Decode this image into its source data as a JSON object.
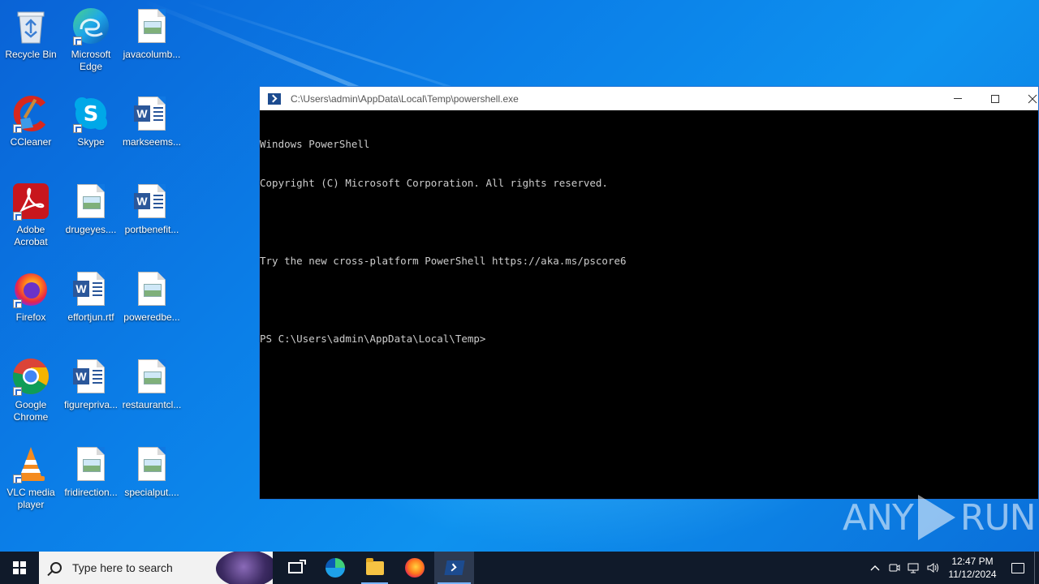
{
  "desktop": {
    "icons": [
      {
        "label": "Recycle Bin",
        "icon": "recycle-bin-icon"
      },
      {
        "label": "Microsoft Edge",
        "icon": "edge-icon"
      },
      {
        "label": "javacolumb...",
        "icon": "image-file-icon"
      },
      {
        "label": "CCleaner",
        "icon": "ccleaner-icon"
      },
      {
        "label": "Skype",
        "icon": "skype-icon"
      },
      {
        "label": "markseems...",
        "icon": "word-doc-icon"
      },
      {
        "label": "Adobe Acrobat",
        "icon": "acrobat-icon"
      },
      {
        "label": "drugeyes....",
        "icon": "image-file-icon"
      },
      {
        "label": "portbenefit...",
        "icon": "word-doc-icon"
      },
      {
        "label": "Firefox",
        "icon": "firefox-icon"
      },
      {
        "label": "effortjun.rtf",
        "icon": "word-doc-icon"
      },
      {
        "label": "poweredbe...",
        "icon": "image-file-icon"
      },
      {
        "label": "Google Chrome",
        "icon": "chrome-icon"
      },
      {
        "label": "figurepriva...",
        "icon": "word-doc-icon"
      },
      {
        "label": "restaurantcl...",
        "icon": "image-file-icon"
      },
      {
        "label": "VLC media player",
        "icon": "vlc-icon"
      },
      {
        "label": "fridirection...",
        "icon": "image-file-icon"
      },
      {
        "label": "specialput....",
        "icon": "image-file-icon"
      }
    ]
  },
  "window": {
    "title": "C:\\Users\\admin\\AppData\\Local\\Temp\\powershell.exe",
    "console_lines": [
      "Windows PowerShell",
      "Copyright (C) Microsoft Corporation. All rights reserved.",
      "",
      "Try the new cross-platform PowerShell https://aka.ms/pscore6",
      "",
      "PS C:\\Users\\admin\\AppData\\Local\\Temp>"
    ]
  },
  "watermark": {
    "left": "ANY",
    "right": "RUN"
  },
  "taskbar": {
    "search_placeholder": "Type here to search",
    "apps": [
      "task-view-icon",
      "edge-icon",
      "file-explorer-icon",
      "firefox-icon",
      "powershell-icon"
    ],
    "clock_time": "12:47 PM",
    "clock_date": "11/12/2024"
  },
  "colors": {
    "desktop_blue": "#0b7fe8",
    "taskbar": "#101a2a",
    "console_bg": "#000000",
    "console_text": "#cccccc"
  }
}
